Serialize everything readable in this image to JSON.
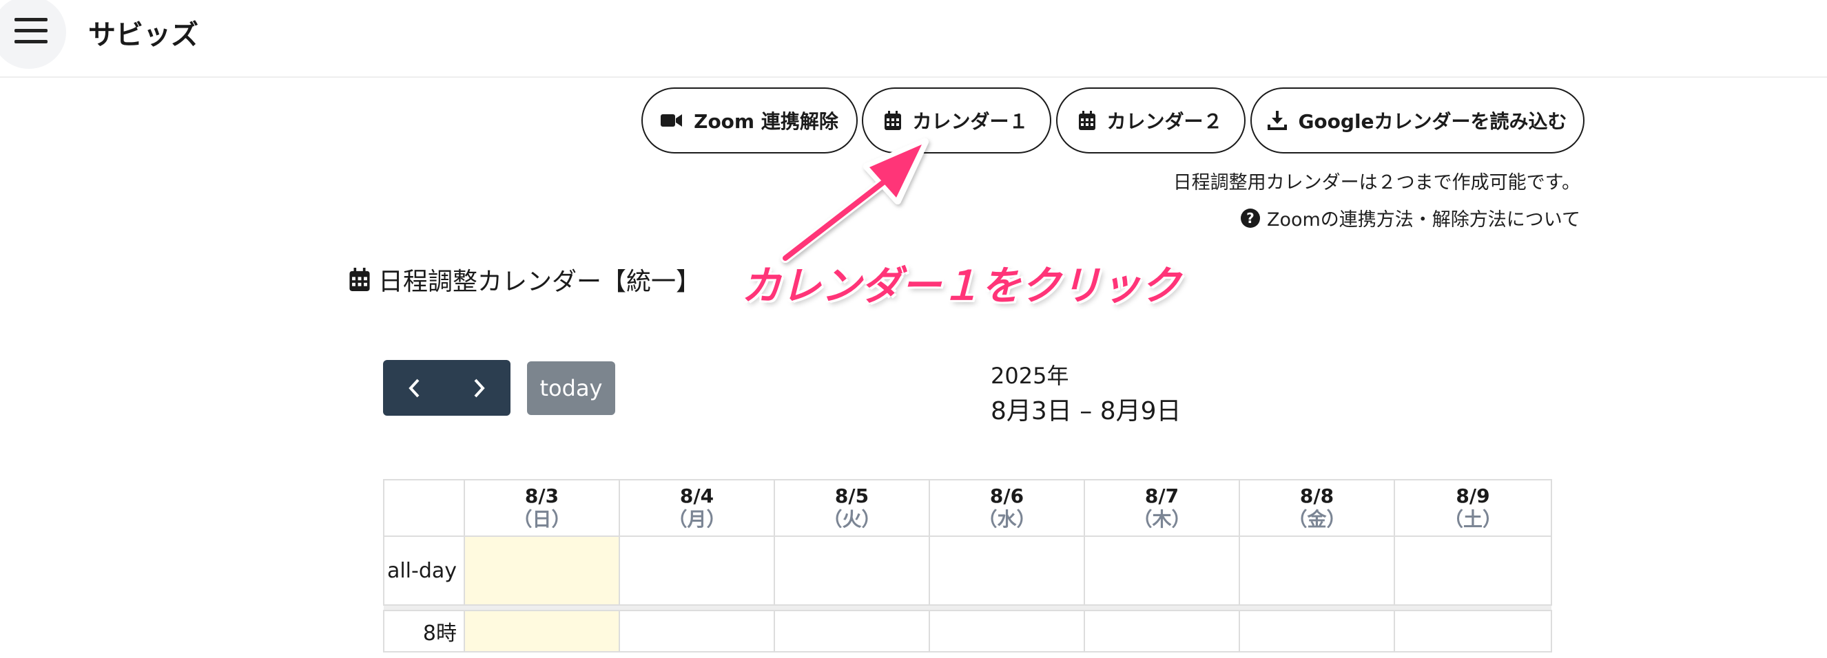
{
  "header": {
    "brand": "サビッズ"
  },
  "top_buttons": {
    "zoom_unlink": "Zoom 連携解除",
    "calendar1": "カレンダー１",
    "calendar2": "カレンダー２",
    "import_google": "Googleカレンダーを読み込む"
  },
  "notes": {
    "limit": "日程調整用カレンダーは２つまで作成可能です。",
    "zoom_help": "Zoomの連携方法・解除方法について"
  },
  "calendar_title": "日程調整カレンダー【統一】",
  "annotation": "カレンダー１をクリック",
  "toolbar": {
    "today_label": "today",
    "year": "2025年",
    "range": "8月3日 – 8月9日"
  },
  "grid": {
    "days": [
      {
        "date": "8/3",
        "dow": "（日）"
      },
      {
        "date": "8/4",
        "dow": "（月）"
      },
      {
        "date": "8/5",
        "dow": "（火）"
      },
      {
        "date": "8/6",
        "dow": "（水）"
      },
      {
        "date": "8/7",
        "dow": "（木）"
      },
      {
        "date": "8/8",
        "dow": "（金）"
      },
      {
        "date": "8/9",
        "dow": "（土）"
      }
    ],
    "allday_label": "all-day",
    "hour_label": "8時"
  },
  "colors": {
    "accent_annotation": "#ff3478",
    "nav_bg": "#2c3e50",
    "today_btn": "#7c858e",
    "today_highlight": "#fffadf"
  },
  "icons": {
    "menu": "hamburger-icon",
    "zoom": "video-camera-icon",
    "calendar": "calendar-icon",
    "download": "download-icon",
    "help": "question-circle-icon",
    "prev": "chevron-left-icon",
    "next": "chevron-right-icon"
  }
}
